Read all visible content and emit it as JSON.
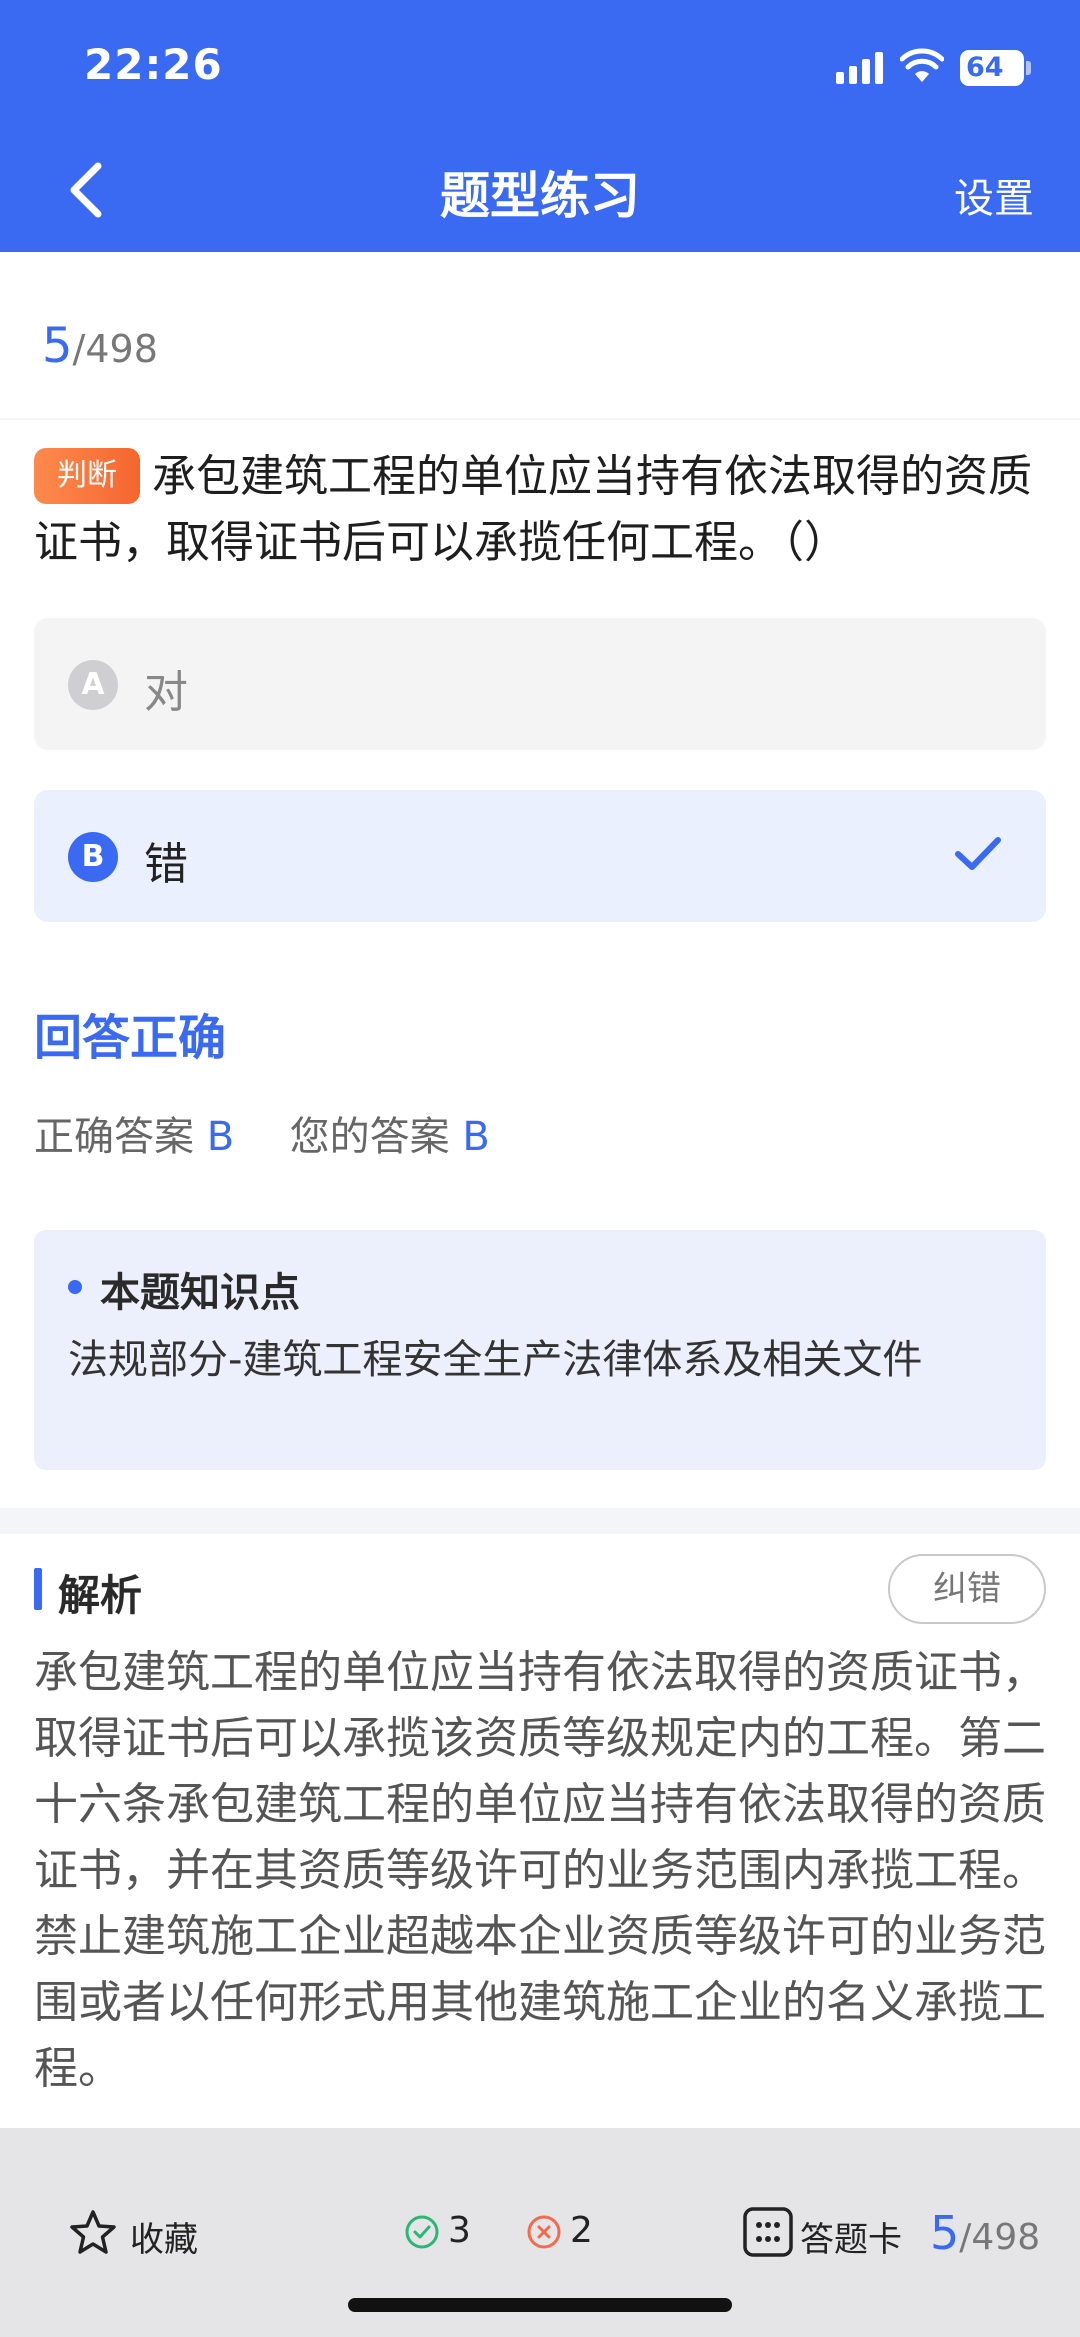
{
  "status_bar": {
    "time": "22:26",
    "battery": "64"
  },
  "nav": {
    "title": "题型练习",
    "settings_label": "设置"
  },
  "progress": {
    "current": "5",
    "total": "/498"
  },
  "question": {
    "tag": "判断",
    "text": "承包建筑工程的单位应当持有依法取得的资质证书，取得证书后可以承揽任何工程。（）"
  },
  "options": [
    {
      "letter": "A",
      "text": "对",
      "selected": false
    },
    {
      "letter": "B",
      "text": "错",
      "selected": true
    }
  ],
  "result": {
    "title": "回答正确",
    "correct_label": "正确答案",
    "correct_value": "B",
    "yours_label": "您的答案",
    "yours_value": "B"
  },
  "knowledge_point": {
    "title": "本题知识点",
    "body": "法规部分-建筑工程安全生产法律体系及相关文件"
  },
  "analysis": {
    "title": "解析",
    "correct_button": "纠错",
    "body": "承包建筑工程的单位应当持有依法取得的资质证书，取得证书后可以承揽该资质等级规定内的工程。第二十六条承包建筑工程的单位应当持有依法取得的资质证书，并在其资质等级许可的业务范围内承揽工程。禁止建筑施工企业超越本企业资质等级许可的业务范围或者以任何形式用其他建筑施工企业的名义承揽工程。"
  },
  "bottom_bar": {
    "favorite_label": "收藏",
    "correct_count": "3",
    "wrong_count": "2",
    "answer_card_label": "答题卡",
    "progress_current": "5",
    "progress_total": "/498"
  },
  "colors": {
    "accent": "#3b6af2",
    "tag": "#f5662f",
    "correct": "#2bb673",
    "wrong": "#f26b4c"
  },
  "icons": [
    "back-arrow-icon",
    "signal-icon",
    "wifi-icon",
    "battery-icon",
    "check-icon",
    "star-icon",
    "correct-circle-icon",
    "wrong-circle-icon",
    "answer-card-icon"
  ]
}
